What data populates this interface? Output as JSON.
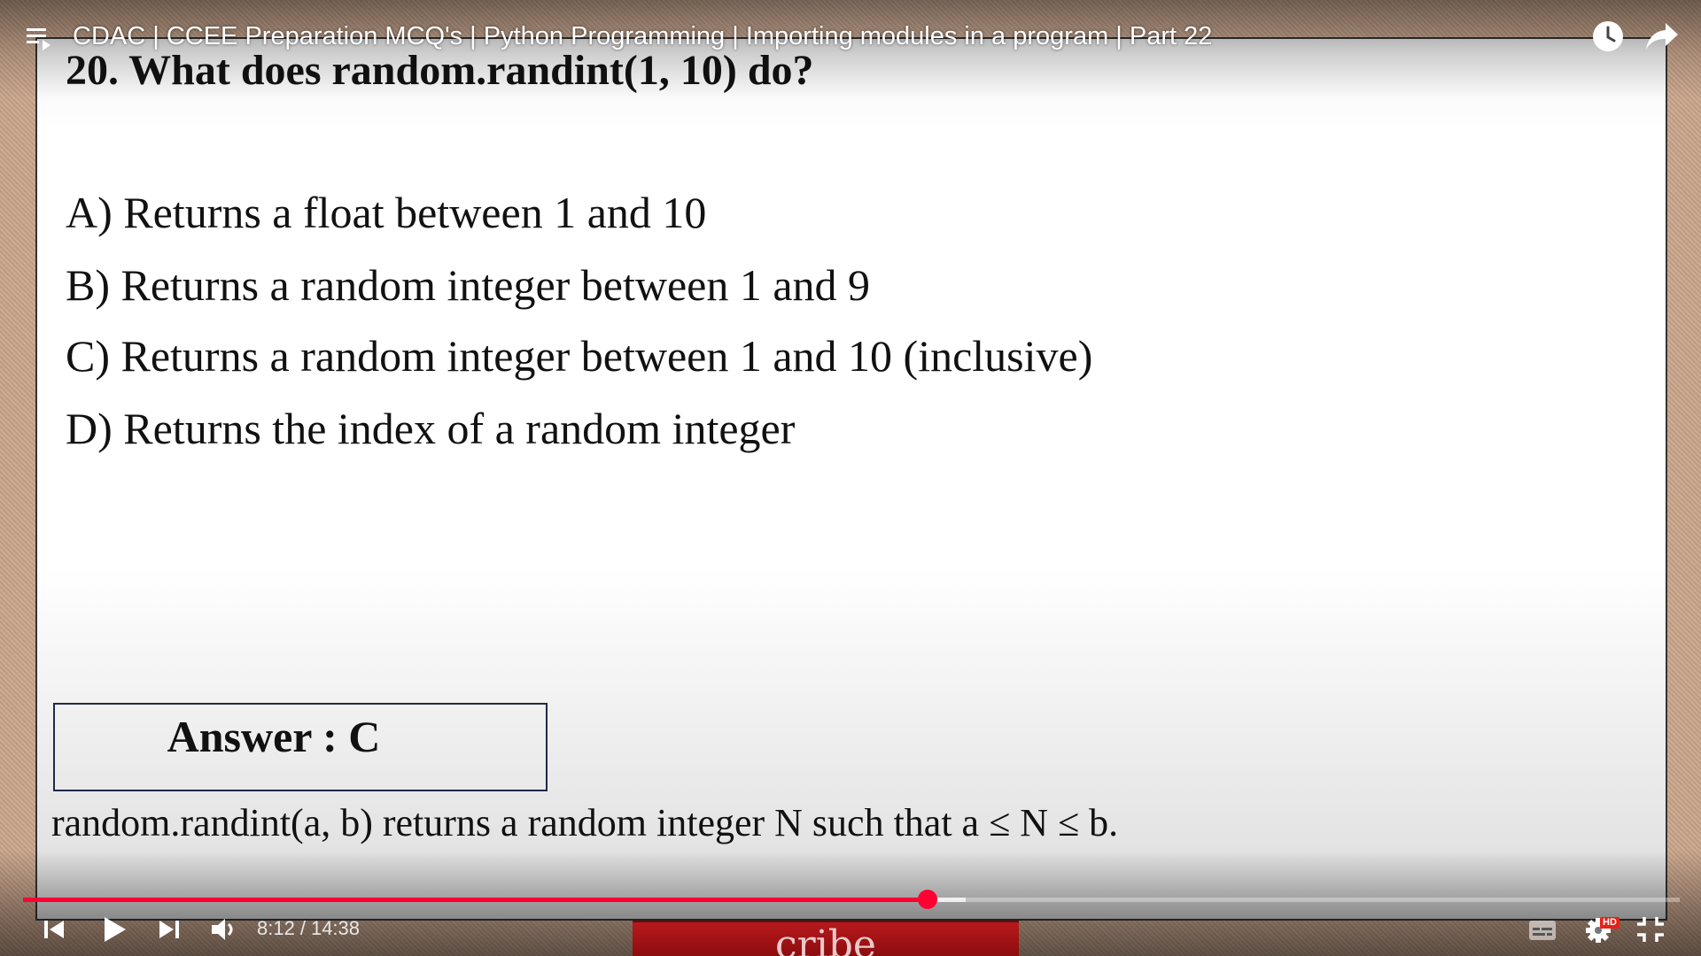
{
  "video": {
    "title": "CDAC | CCEE Preparation MCQ's | Python Programming | Importing modules in a program | Part 22",
    "current_time": "8:12",
    "total_time": "14:38",
    "time_separator": "/",
    "progress_fraction": 0.546,
    "buffered_fraction": 0.569,
    "quality_badge": "HD",
    "overlay_partial_text": "cribe"
  },
  "slide": {
    "question": "20. What does random.randint(1, 10) do?",
    "options": [
      "A) Returns a float between 1 and 10",
      "B) Returns a random integer between 1 and 9",
      "C) Returns a random integer between 1 and 10 (inclusive)",
      "D) Returns the index of a random integer"
    ],
    "answer": "Answer : C",
    "explanation": "random.randint(a, b) returns a random integer N such that a ≤ N ≤ b."
  },
  "icons": {
    "playlist": "playlist-icon",
    "watch_later": "watch-later-icon",
    "share": "share-icon",
    "prev": "skip-previous-icon",
    "play": "play-icon",
    "next": "skip-next-icon",
    "volume": "volume-icon",
    "captions": "captions-icon",
    "settings": "settings-icon",
    "fullscreen_exit": "fullscreen-exit-icon"
  },
  "colors": {
    "progress_played": "#ff0033",
    "scrubber": "#ff0033",
    "controls": "#ffffff"
  }
}
